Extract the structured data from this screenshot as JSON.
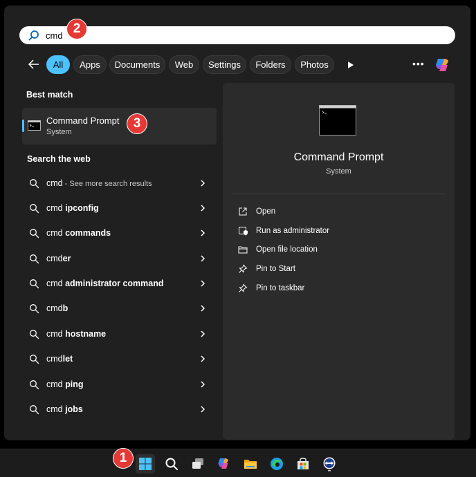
{
  "search": {
    "value": "cmd",
    "placeholder": ""
  },
  "markers": [
    "1",
    "2",
    "3"
  ],
  "filters": [
    "All",
    "Apps",
    "Documents",
    "Web",
    "Settings",
    "Folders",
    "Photos"
  ],
  "more_label": "•••",
  "best_match": {
    "heading": "Best match",
    "title": "Command Prompt",
    "subtitle": "System"
  },
  "web": {
    "heading": "Search the web",
    "items": [
      {
        "prefix": "cmd",
        "bold": "",
        "suffix": " - See more search results"
      },
      {
        "prefix": "cmd ",
        "bold": "ipconfig",
        "suffix": ""
      },
      {
        "prefix": "cmd ",
        "bold": "commands",
        "suffix": ""
      },
      {
        "prefix": "cmd",
        "bold": "er",
        "suffix": ""
      },
      {
        "prefix": "cmd ",
        "bold": "administrator command",
        "suffix": ""
      },
      {
        "prefix": "cmd",
        "bold": "b",
        "suffix": ""
      },
      {
        "prefix": "cmd ",
        "bold": "hostname",
        "suffix": ""
      },
      {
        "prefix": "cmd",
        "bold": "let",
        "suffix": ""
      },
      {
        "prefix": "cmd ",
        "bold": "ping",
        "suffix": ""
      },
      {
        "prefix": "cmd ",
        "bold": "jobs",
        "suffix": ""
      }
    ]
  },
  "detail": {
    "title": "Command Prompt",
    "category": "System",
    "actions": [
      "Open",
      "Run as administrator",
      "Open file location",
      "Pin to Start",
      "Pin to taskbar"
    ]
  },
  "taskbar": {
    "icons": [
      "windows-start-icon",
      "search-icon",
      "task-view-icon",
      "copilot-icon",
      "file-explorer-icon",
      "edge-icon",
      "microsoft-store-icon",
      "teamviewer-icon"
    ]
  },
  "colors": {
    "accent": "#4cc2ff",
    "marker": "#e53935",
    "panel": "#202020",
    "detail": "#2b2b2b"
  }
}
